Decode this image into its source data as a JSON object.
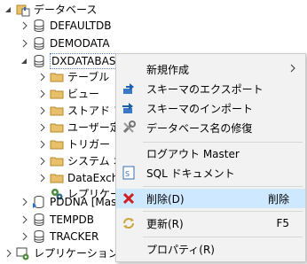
{
  "tree": {
    "root": {
      "label": "データベース"
    },
    "items": [
      {
        "label": "DEFAULTDB"
      },
      {
        "label": "DEMODATA"
      },
      {
        "label": "DXDATABASE"
      },
      {
        "label": "テーブル"
      },
      {
        "label": "ビュー"
      },
      {
        "label": "ストアド プロ"
      },
      {
        "label": "ユーザー定義"
      },
      {
        "label": "トリガー"
      },
      {
        "label": "システム オブ"
      },
      {
        "label": "DataExcha"
      },
      {
        "label": "レプリケーシ"
      },
      {
        "label": "PDDNA [Mas"
      },
      {
        "label": "TEMPDB"
      },
      {
        "label": "TRACKER"
      },
      {
        "label": "レプリケーション - 接"
      }
    ]
  },
  "context_menu": {
    "items": [
      {
        "label": "新規作成",
        "shortcut": ""
      },
      {
        "label": "スキーマのエクスポート",
        "shortcut": ""
      },
      {
        "label": "スキーマのインポート",
        "shortcut": ""
      },
      {
        "label": "データベース名の修復",
        "shortcut": ""
      },
      {
        "label": "ログアウト Master",
        "shortcut": ""
      },
      {
        "label": "SQL ドキュメント",
        "shortcut": ""
      },
      {
        "label": "削除(D)",
        "shortcut": "削除"
      },
      {
        "label": "更新(R)",
        "shortcut": "F5"
      },
      {
        "label": "プロパティ(R)",
        "shortcut": ""
      }
    ]
  },
  "colors": {
    "menu_bg": "#f2f2f2",
    "selected_bg": "#cde8ff",
    "folder": "#e8c06a",
    "database": "#555555"
  }
}
